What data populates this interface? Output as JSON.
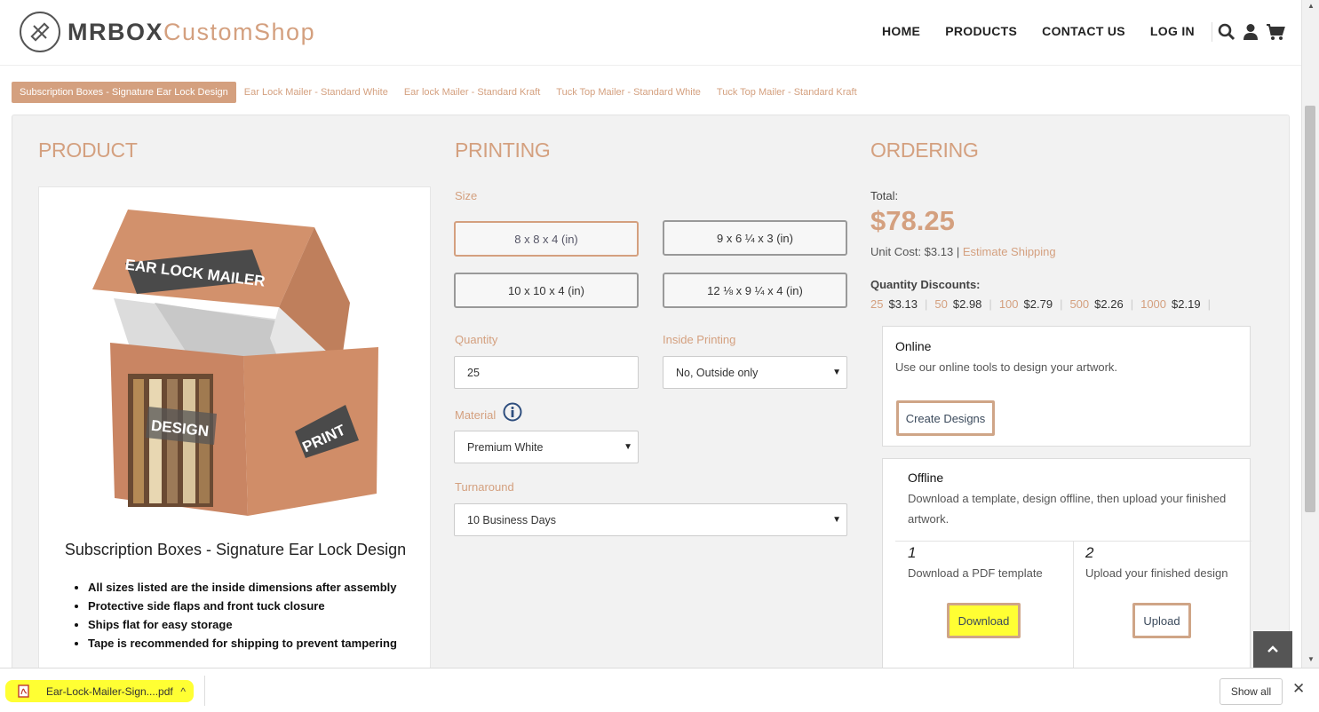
{
  "brand": {
    "part1": "MRBOX",
    "part2": "CustomShop"
  },
  "nav": {
    "items": [
      "HOME",
      "PRODUCTS",
      "CONTACT US",
      "LOG IN"
    ]
  },
  "icons": {
    "search": "search-icon",
    "user": "user-icon",
    "cart": "cart-icon"
  },
  "tabs": [
    "Subscription Boxes - Signature Ear Lock Design",
    "Ear Lock Mailer - Standard White",
    "Ear lock Mailer - Standard Kraft",
    "Tuck Top Mailer - Standard White",
    "Tuck Top Mailer - Standard Kraft"
  ],
  "product": {
    "section_title": "PRODUCT",
    "box_labels": {
      "top": "EAR LOCK MAILER",
      "front": "DESIGN",
      "side": "PRINT"
    },
    "name": "Subscription Boxes - Signature Ear Lock Design",
    "bullets": [
      "All sizes listed are the inside dimensions after assembly",
      "Protective side flaps and front tuck closure",
      "Ships flat for easy storage",
      "Tape is recommended for shipping to prevent tampering"
    ]
  },
  "printing": {
    "section_title": "PRINTING",
    "size_label": "Size",
    "sizes": [
      "8 x 8 x 4 (in)",
      "9 x 6 ¼ x 3 (in)",
      "10 x 10 x 4 (in)",
      "12 ⅛ x 9 ¼ x 4 (in)"
    ],
    "quantity_label": "Quantity",
    "quantity_value": "25",
    "inside_label": "Inside Printing",
    "inside_value": "No, Outside only",
    "material_label": "Material",
    "material_value": "Premium White",
    "turnaround_label": "Turnaround",
    "turnaround_value": "10 Business Days"
  },
  "ordering": {
    "section_title": "ORDERING",
    "total_label": "Total:",
    "total": "$78.25",
    "unit_cost": "Unit Cost: $3.13",
    "unit_sep": "|",
    "estimate_shipping": "Estimate Shipping",
    "qd_label": "Quantity Discounts:",
    "discounts": [
      {
        "qty": "25",
        "price": "$3.13"
      },
      {
        "qty": "50",
        "price": "$2.98"
      },
      {
        "qty": "100",
        "price": "$2.79"
      },
      {
        "qty": "500",
        "price": "$2.26"
      },
      {
        "qty": "1000",
        "price": "$2.19"
      }
    ],
    "online": {
      "title": "Online",
      "desc": "Use our online tools to design your artwork.",
      "button": "Create Designs"
    },
    "offline": {
      "title": "Offline",
      "desc1": "Download a template, design offline, then upload your finished",
      "desc2": "artwork.",
      "step1_num": "1",
      "step1_text": "Download a PDF template",
      "step1_button": "Download",
      "step2_num": "2",
      "step2_text": "Upload your finished design",
      "step2_button": "Upload"
    }
  },
  "download_bar": {
    "file_name": "Ear-Lock-Mailer-Sign....pdf",
    "show_all": "Show all"
  },
  "colors": {
    "accent": "#d4a07f",
    "highlight": "#ffff33"
  }
}
